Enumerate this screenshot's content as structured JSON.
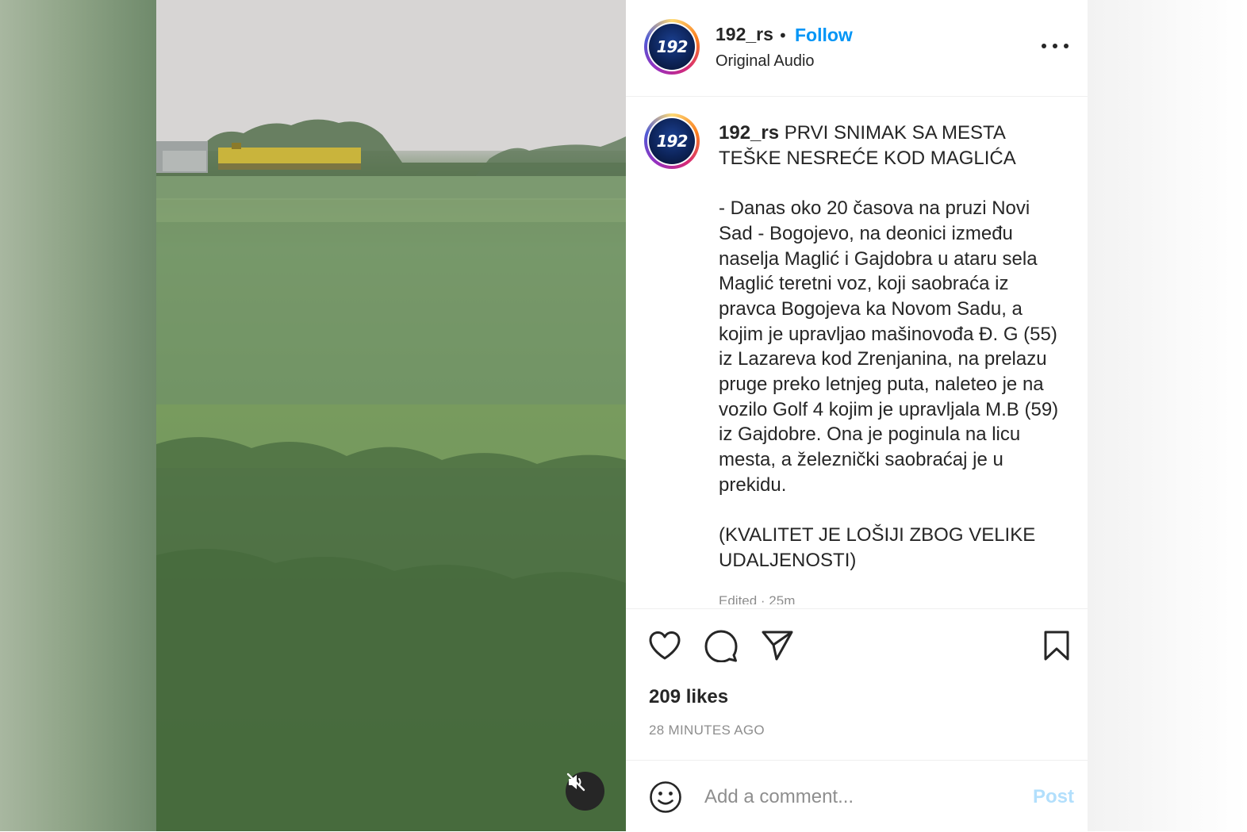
{
  "post": {
    "username": "192_rs",
    "dot": "•",
    "follow_label": "Follow",
    "audio_label": "Original Audio",
    "avatar_text": "192",
    "caption_username": "192_rs",
    "caption": " PRVI SNIMAK SA MESTA TEŠKE NESREĆE KOD MAGLIĆA\n\n- Danas oko 20 časova na pruzi Novi Sad - Bogojevo, na deonici između naselja Maglić i Gajdobra u ataru sela Maglić teretni voz, koji saobraća iz pravca Bogojeva ka Novom Sadu, a kojim je upravljao mašinovođa Đ. G (55) iz Lazareva kod Zrenjanina, na prelazu pruge preko letnjeg puta, naleteo je na vozilo Golf 4 kojim je upravljala M.B (59) iz Gajdobre. Ona je poginula na licu mesta, a železnički saobraćaj je u prekidu.\n\n(KVALITET JE LOŠIJI ZBOG VELIKE UDALJENOSTI)",
    "edited_label": "Edited · 25m",
    "likes": "209 likes",
    "time_ago": "28 MINUTES AGO",
    "comment_placeholder": "Add a comment...",
    "post_label": "Post"
  },
  "icons": {
    "more": "more-options-icon",
    "like": "heart-icon",
    "comment": "comment-bubble-icon",
    "share": "paper-plane-icon",
    "save": "bookmark-icon",
    "emoji": "emoji-icon",
    "mute": "speaker-muted-icon"
  },
  "colors": {
    "follow": "#0095f6",
    "post_disabled": "#b2dffc",
    "text": "#262626",
    "secondary": "#8e8e8e"
  }
}
